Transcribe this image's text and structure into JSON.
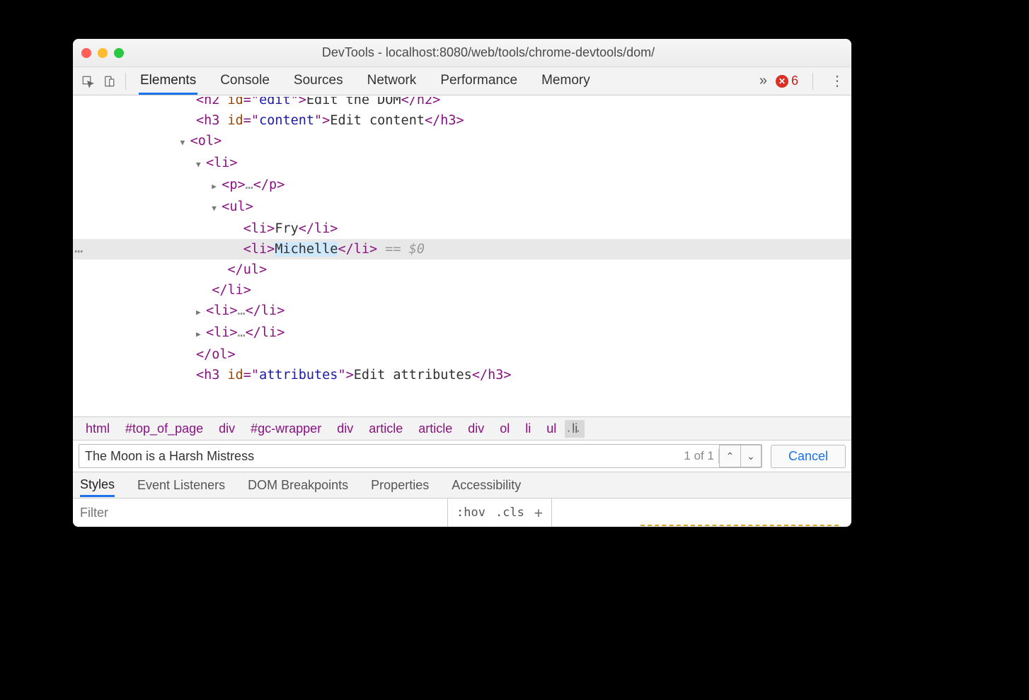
{
  "window": {
    "title": "DevTools - localhost:8080/web/tools/chrome-devtools/dom/"
  },
  "tabs": {
    "items": [
      "Elements",
      "Console",
      "Sources",
      "Network",
      "Performance",
      "Memory"
    ],
    "active": "Elements",
    "overflow_glyph": "»",
    "error_count": "6"
  },
  "dom": {
    "h2_id": "edit",
    "h2_text": "Edit the DOM",
    "h3a_id": "content",
    "h3a_text": "Edit content",
    "li_fry": "Fry",
    "li_sel": "Michelle",
    "sel_ref": "== $0",
    "h3b_id": "attributes",
    "h3b_text": "Edit attributes",
    "ellipsis": "…"
  },
  "breadcrumbs": [
    "html",
    "#top_of_page",
    "div",
    "#gc-wrapper",
    "div",
    "article",
    "article",
    "div",
    "ol",
    "li",
    "ul",
    "li"
  ],
  "find": {
    "value": "The Moon is a Harsh Mistress",
    "count": "1 of 1",
    "cancel": "Cancel",
    "up": "⌃",
    "down": "⌄"
  },
  "subtabs": {
    "items": [
      "Styles",
      "Event Listeners",
      "DOM Breakpoints",
      "Properties",
      "Accessibility"
    ],
    "active": "Styles"
  },
  "styles": {
    "filter_placeholder": "Filter",
    "hov": ":hov",
    "cls": ".cls",
    "plus": "+"
  }
}
